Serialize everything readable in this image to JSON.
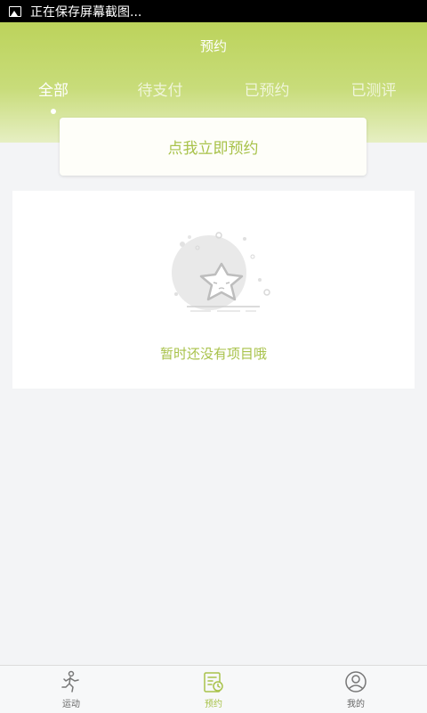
{
  "status_bar": {
    "notification_text": "正在保存屏幕截图..."
  },
  "header": {
    "title": "预约"
  },
  "tabs": [
    {
      "label": "全部",
      "active": true
    },
    {
      "label": "待支付",
      "active": false
    },
    {
      "label": "已预约",
      "active": false
    },
    {
      "label": "已测评",
      "active": false
    }
  ],
  "book_button": {
    "label": "点我立即预约"
  },
  "empty_state": {
    "message": "暂时还没有项目哦",
    "icon": "star-empty-icon"
  },
  "bottom_nav": [
    {
      "label": "运动",
      "icon": "runner-icon",
      "active": false
    },
    {
      "label": "预约",
      "icon": "calendar-clock-icon",
      "active": true
    },
    {
      "label": "我的",
      "icon": "user-icon",
      "active": false
    }
  ],
  "colors": {
    "accent": "#a8c24a",
    "header_green": "#bcd35b",
    "background": "#f3f4f6"
  }
}
